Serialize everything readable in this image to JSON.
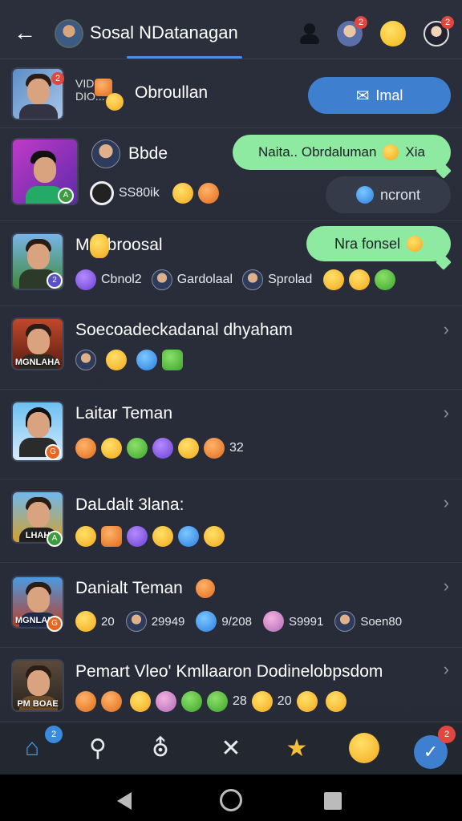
{
  "header": {
    "title": "Sosal NDatanagan",
    "badges": {
      "avatar2": "2",
      "avatar3": "2"
    }
  },
  "rows": [
    {
      "title": "Obroullan",
      "thumb_badge": "2",
      "small_label": "VID\nDIO...",
      "action_label": "Imal"
    },
    {
      "title": "Bbde",
      "sub_text": "SS80ik",
      "bubble": "Naita.. Obrdaluman",
      "bubble_suffix": "Xia",
      "action_label": "ncront"
    },
    {
      "title": "M  Obroosal",
      "people": [
        "Cbnol2",
        "Gardolaal",
        "Sprolad"
      ],
      "bubble": "Nra fonsel"
    },
    {
      "title": "Soecoadeckadanal dhyaham",
      "thumb_caption": "MGNLAHA"
    },
    {
      "title": "Laitar Teman",
      "count": "32"
    },
    {
      "title": "DaLdalt 3lana:",
      "thumb_caption": "LHAH"
    },
    {
      "title": "Danialt Teman",
      "count": "20",
      "stats": [
        "29949",
        "9/208",
        "S9991",
        "Soen80"
      ],
      "thumb_caption": "MGNLAHA"
    },
    {
      "title": "Pemart Vleo' Kmllaaron Dodinelobpsdom",
      "counts": [
        "28",
        "20"
      ],
      "thumb_caption": "PM BOAE"
    }
  ],
  "bottom_nav": {
    "home_badge": "2",
    "check_badge": "2",
    "icons": [
      "home-icon",
      "search-icon",
      "shield-icon",
      "close-tools-icon",
      "star-icon",
      "emoji-icon",
      "check-icon"
    ]
  },
  "colors": {
    "accent": "#4a90e2",
    "bubble_green": "#8eeaa0",
    "button_blue": "#3f7fd0",
    "badge_red": "#e2463f"
  }
}
